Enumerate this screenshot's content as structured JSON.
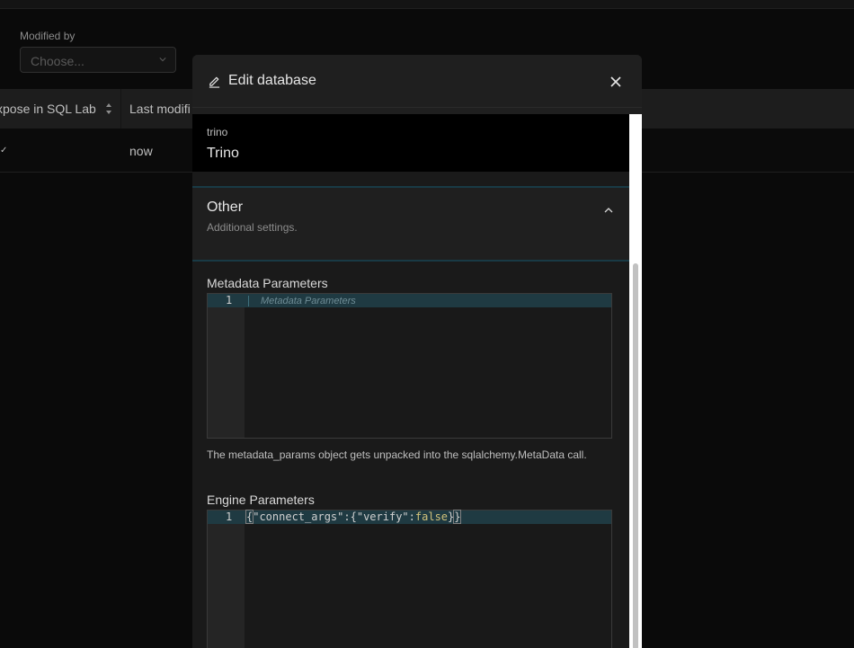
{
  "background": {
    "filter": {
      "label": "Modified by",
      "placeholder": "Choose..."
    },
    "table": {
      "columns": [
        "xpose in SQL Lab",
        "Last modifi"
      ],
      "rows": [
        {
          "expose": "✓",
          "last_modified": "now"
        }
      ]
    }
  },
  "modal": {
    "title": "Edit database",
    "database": {
      "engine": "trino",
      "name": "Trino"
    },
    "section": {
      "title": "Other",
      "subtitle": "Additional settings."
    },
    "metadata": {
      "label": "Metadata Parameters",
      "line_number": "1",
      "placeholder": "Metadata Parameters",
      "help": "The metadata_params object gets unpacked into the sqlalchemy.MetaData call."
    },
    "engine": {
      "label": "Engine Parameters",
      "line_number": "1",
      "code": {
        "open": "{",
        "key1": "\"connect_args\"",
        "colon": ":",
        "open2": "{",
        "key2": "\"verify\"",
        "colon2": ":",
        "value": "false",
        "close2": "}",
        "close": "}"
      }
    }
  },
  "colors": {
    "accent_border": "#193a45",
    "active_line": "#1f3a42",
    "keyword": "#d2c27a"
  },
  "icons": [
    "edit-icon",
    "close-icon",
    "chevron-down-icon",
    "sort-icon",
    "caret-up-icon"
  ]
}
